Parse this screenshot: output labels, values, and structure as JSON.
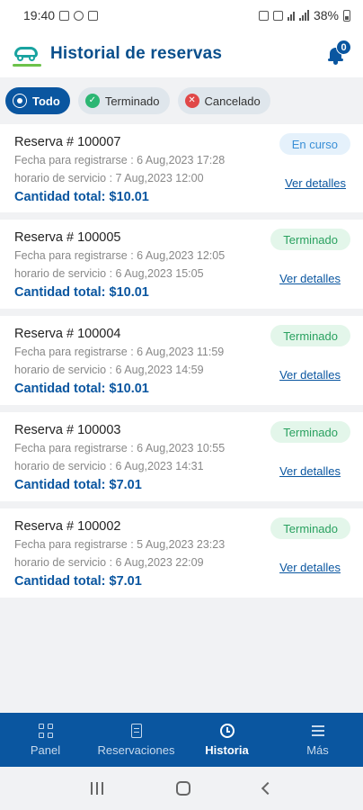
{
  "status_bar": {
    "time": "19:40",
    "battery": "38%"
  },
  "header": {
    "title": "Historial de reservas",
    "notification_count": "0"
  },
  "filters": [
    {
      "label": "Todo",
      "icon": "all-icon",
      "active": true
    },
    {
      "label": "Terminado",
      "icon": "check-circle-icon",
      "active": false
    },
    {
      "label": "Cancelado",
      "icon": "x-circle-icon",
      "active": false
    }
  ],
  "reservations": [
    {
      "id": "Reserva # 100007",
      "registered": "Fecha para registrarse : 6 Aug,2023 17:28",
      "service": "horario de servicio : 7 Aug,2023 12:00",
      "total": "Cantidad total: $10.01",
      "status": "En curso",
      "link": "Ver detalles"
    },
    {
      "id": "Reserva # 100005",
      "registered": "Fecha para registrarse : 6 Aug,2023 12:05",
      "service": "horario de servicio : 6 Aug,2023 15:05",
      "total": "Cantidad total: $10.01",
      "status": "Terminado",
      "link": "Ver detalles"
    },
    {
      "id": "Reserva # 100004",
      "registered": "Fecha para registrarse : 6 Aug,2023 11:59",
      "service": "horario de servicio : 6 Aug,2023 14:59",
      "total": "Cantidad total: $10.01",
      "status": "Terminado",
      "link": "Ver detalles"
    },
    {
      "id": "Reserva # 100003",
      "registered": "Fecha para registrarse : 6 Aug,2023 10:55",
      "service": "horario de servicio : 6 Aug,2023 14:31",
      "total": "Cantidad total: $7.01",
      "status": "Terminado",
      "link": "Ver detalles"
    },
    {
      "id": "Reserva # 100002",
      "registered": "Fecha para registrarse : 5 Aug,2023 23:23",
      "service": "horario de servicio : 6 Aug,2023 22:09",
      "total": "Cantidad total: $7.01",
      "status": "Terminado",
      "link": "Ver detalles"
    }
  ],
  "bottom_nav": [
    {
      "label": "Panel",
      "icon": "dashboard-icon",
      "active": false
    },
    {
      "label": "Reservaciones",
      "icon": "document-icon",
      "active": false
    },
    {
      "label": "Historia",
      "icon": "history-icon",
      "active": true
    },
    {
      "label": "Más",
      "icon": "menu-icon",
      "active": false
    }
  ],
  "colors": {
    "primary": "#0a56a0",
    "done": "#2aa160",
    "in_progress": "#3a8fd6",
    "cancel": "#e04848"
  }
}
